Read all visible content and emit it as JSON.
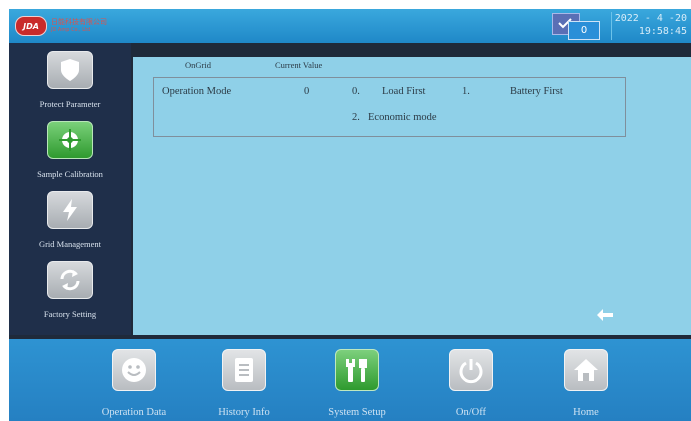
{
  "logo": {
    "badge": "JDA",
    "company_cn": "日能科技有限公司",
    "company_en": "JD Amp Co., Ltd"
  },
  "header": {
    "counter": "0",
    "date": "2022 - 4 -20",
    "time": "19:58:45"
  },
  "sidebar": {
    "items": [
      {
        "label": "Protect Parameter",
        "icon": "shield-icon",
        "active": false
      },
      {
        "label": "Sample Calibration",
        "icon": "crosshair-icon",
        "active": true
      },
      {
        "label": "Grid Management",
        "icon": "lightning-icon",
        "active": false
      },
      {
        "label": "Factory Setting",
        "icon": "refresh-icon",
        "active": false
      }
    ]
  },
  "main": {
    "headers": {
      "ongrid": "OnGrid",
      "current_value": "Current Value"
    },
    "param": {
      "name": "Operation Mode",
      "current_value": "0",
      "options": [
        {
          "num": "0.",
          "label": "Load First"
        },
        {
          "num": "1.",
          "label": "Battery First"
        },
        {
          "num": "2.",
          "label": "Economic mode"
        }
      ]
    },
    "back_icon": "arrow-left-icon"
  },
  "nav": {
    "items": [
      {
        "label": "Operation Data",
        "icon": "smiley-icon",
        "active": false
      },
      {
        "label": "History Info",
        "icon": "document-icon",
        "active": false
      },
      {
        "label": "System Setup",
        "icon": "tools-icon",
        "active": true
      },
      {
        "label": "On/Off",
        "icon": "power-icon",
        "active": false
      },
      {
        "label": "Home",
        "icon": "home-icon",
        "active": false
      }
    ]
  },
  "colors": {
    "topbar": "#2a96d2",
    "main_bg": "#8fd0e8",
    "sidebar": "#1f2f4a",
    "active_green": "#3fa83f"
  }
}
